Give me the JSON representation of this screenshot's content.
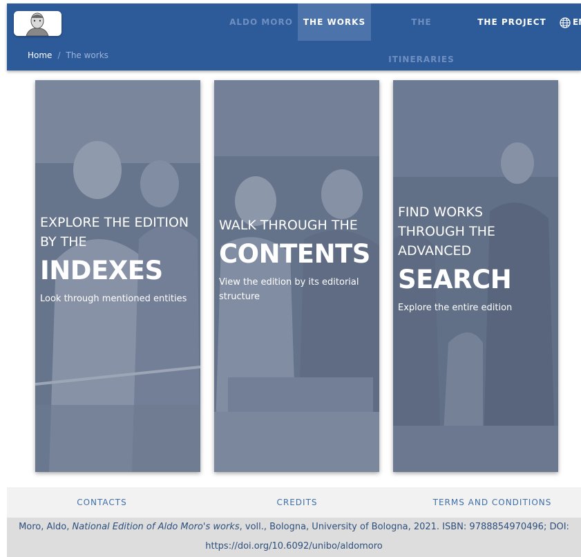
{
  "header": {
    "logo_alt": "Aldo Moro portrait",
    "nav": [
      {
        "label": "ALDO MORO",
        "state": "dim"
      },
      {
        "label": "THE WORKS",
        "state": "active"
      },
      {
        "label": "THE ITINERARIES",
        "state": "dim"
      },
      {
        "label": "THE PROJECT",
        "state": "normal"
      }
    ],
    "language": {
      "icon": "globe-icon",
      "label": "EN"
    }
  },
  "breadcrumb": {
    "home": "Home",
    "separator": "/",
    "current": "The works"
  },
  "cards": [
    {
      "lead": "EXPLORE THE EDITION BY THE",
      "big": "INDEXES",
      "sub": "Look through mentioned entities"
    },
    {
      "lead": "WALK THROUGH THE",
      "big": "CONTENTS",
      "sub": "View the edition by its editorial structure"
    },
    {
      "lead": "FIND WORKS THROUGH THE ADVANCED",
      "big": "SEARCH",
      "sub": "Explore the entire edition"
    }
  ],
  "footer": {
    "links": [
      "CONTACTS",
      "CREDITS",
      "TERMS AND CONDITIONS"
    ],
    "citation": {
      "author": "Moro, Aldo,",
      "title": "National Edition of Aldo Moro's works",
      "rest": ", voll., Bologna, University of Bologna, 2021. ISBN: 9788854970496; DOI:",
      "doi": "https://doi.org/10.6092/unibo/aldomoro"
    }
  },
  "colors": {
    "header_bg": "#2d5b9a",
    "active_tab": "#4c74ab",
    "card_overlay": "#6e7c96",
    "link": "#3d6fa8"
  }
}
